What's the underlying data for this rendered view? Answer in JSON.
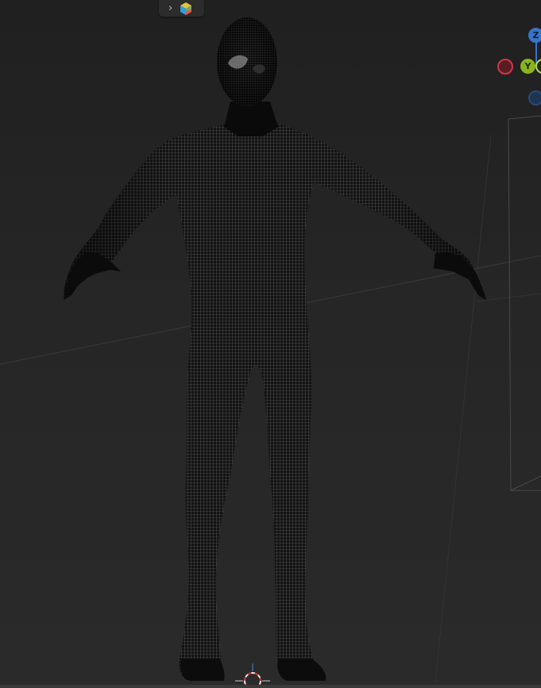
{
  "viewport": {
    "background": "#262626",
    "mesh_color": "#0e0e0e",
    "wire_color": "#6a6a6a"
  },
  "header": {
    "expand_icon": "chevron-right-icon",
    "navigation_icon": "cube-icon"
  },
  "gizmo": {
    "z_label": "Z",
    "y_label": "Y",
    "x_color": "#d2354a",
    "y_color": "#8ab41d",
    "z_color": "#3673c9",
    "neg_z_color": "#2b4a73"
  },
  "cursor": {
    "icon": "3d-cursor-icon"
  }
}
